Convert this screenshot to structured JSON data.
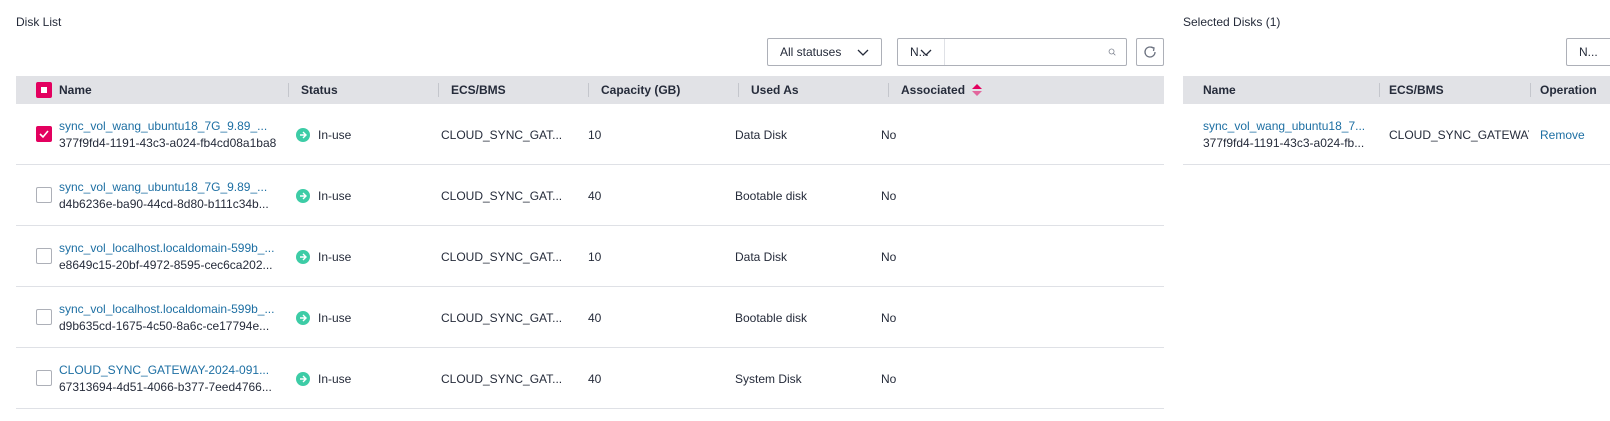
{
  "left": {
    "title": "Disk List",
    "status_filter": "All statuses",
    "search_property": "N...",
    "search_placeholder": "",
    "columns": [
      "Name",
      "Status",
      "ECS/BMS",
      "Capacity (GB)",
      "Used As",
      "Associated"
    ],
    "rows": [
      {
        "checked": true,
        "name": "sync_vol_wang_ubuntu18_7G_9.89_...",
        "id": "377f9fd4-1191-43c3-a024-fb4cd08a1ba8",
        "status": "In-use",
        "ecs": "CLOUD_SYNC_GAT...",
        "capacity": "10",
        "used_as": "Data Disk",
        "associated": "No"
      },
      {
        "checked": false,
        "name": "sync_vol_wang_ubuntu18_7G_9.89_...",
        "id": "d4b6236e-ba90-44cd-8d80-b111c34b...",
        "status": "In-use",
        "ecs": "CLOUD_SYNC_GAT...",
        "capacity": "40",
        "used_as": "Bootable disk",
        "associated": "No"
      },
      {
        "checked": false,
        "name": "sync_vol_localhost.localdomain-599b_...",
        "id": "e8649c15-20bf-4972-8595-cec6ca202...",
        "status": "In-use",
        "ecs": "CLOUD_SYNC_GAT...",
        "capacity": "10",
        "used_as": "Data Disk",
        "associated": "No"
      },
      {
        "checked": false,
        "name": "sync_vol_localhost.localdomain-599b_...",
        "id": "d9b635cd-1675-4c50-8a6c-ce17794e...",
        "status": "In-use",
        "ecs": "CLOUD_SYNC_GAT...",
        "capacity": "40",
        "used_as": "Bootable disk",
        "associated": "No"
      },
      {
        "checked": false,
        "name": "CLOUD_SYNC_GATEWAY-2024-091...",
        "id": "67313694-4d51-4066-b377-7eed4766...",
        "status": "In-use",
        "ecs": "CLOUD_SYNC_GAT...",
        "capacity": "40",
        "used_as": "System Disk",
        "associated": "No"
      }
    ]
  },
  "right": {
    "title": "Selected Disks (1)",
    "search_property": "N...",
    "columns": [
      "Name",
      "ECS/BMS",
      "Operation"
    ],
    "rows": [
      {
        "name": "sync_vol_wang_ubuntu18_7...",
        "id": "377f9fd4-1191-43c3-a024-fb...",
        "ecs": "CLOUD_SYNC_GATEWAY",
        "operation": "Remove"
      }
    ]
  },
  "colors": {
    "accent": "#e3005f",
    "link": "#1e73b4",
    "status_ok": "#3dcca6",
    "header_bg": "#e1e2e6"
  }
}
